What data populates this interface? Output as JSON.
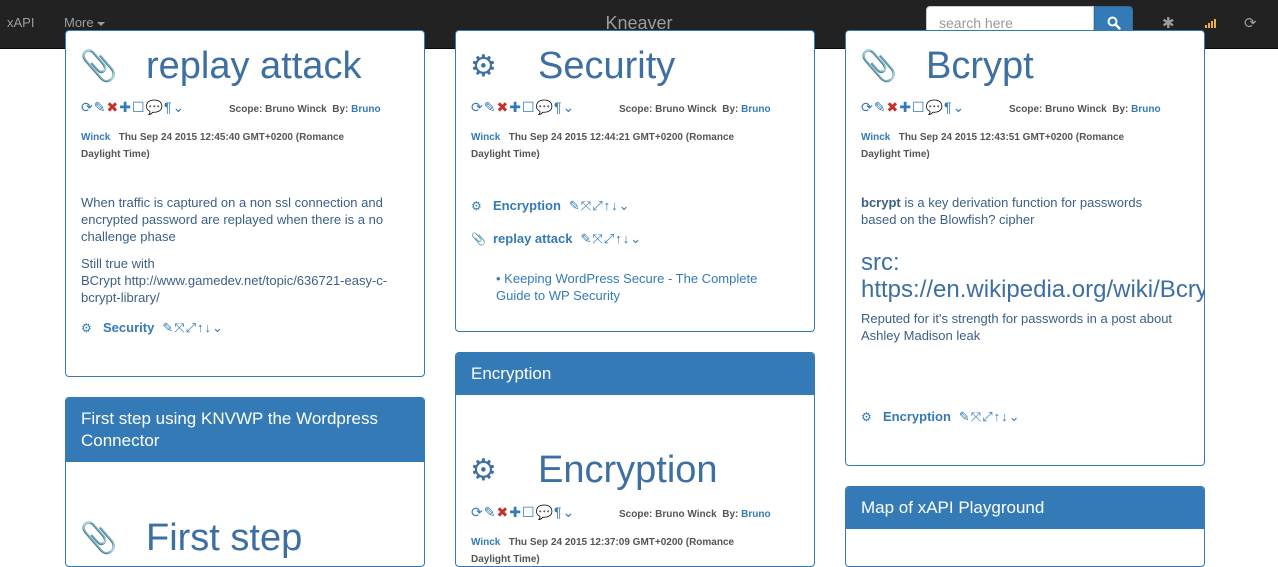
{
  "nav": {
    "left_link": "xAPI",
    "more_label": "More",
    "brand": "Kneaver",
    "search_placeholder": "search here",
    "icons": [
      "search-icon",
      "asterisk-icon",
      "signal-icon",
      "refresh-icon"
    ]
  },
  "colors": {
    "primary": "#337ab7",
    "navbar": "#222222",
    "danger": "#c9302c",
    "signal": "#f0ad4e"
  },
  "tool_glyphs": "⟳✎✖✚☐💬¶⌄",
  "link_actions": "✎⤧⤢↑↓⌄",
  "cards": {
    "replay": {
      "title": "replay attack",
      "scope_label": "Scope:",
      "scope": "Bruno Winck",
      "by_label": "By:",
      "by": "Bruno",
      "author": "Winck",
      "date_line1": "Thu Sep 24 2015 12:45:40 GMT+0200 (Romance",
      "date_line2": "Daylight Time)",
      "para1": "When traffic is captured on a non ssl connection and encrypted password are replayed when there is a no challenge phase",
      "para2_a": "Still true with",
      "para2_b": "BCrypt http://www.gamedev.net/topic/636721-easy-c-bcrypt-library/",
      "link1": "Security"
    },
    "security": {
      "title": "Security",
      "scope_label": "Scope:",
      "scope": "Bruno Winck",
      "by_label": "By:",
      "by": "Bruno",
      "author": "Winck",
      "date_line1": "Thu Sep 24 2015 12:44:21 GMT+0200 (Romance",
      "date_line2": "Daylight Time)",
      "link1": "Encryption",
      "link2": "replay attack",
      "bullet": "Keeping WordPress Secure - The Complete Guide to WP Security"
    },
    "bcrypt": {
      "title": "Bcrypt",
      "scope_label": "Scope:",
      "scope": "Bruno Winck",
      "by_label": "By:",
      "by": "Bruno",
      "author": "Winck",
      "date_line1": "Thu Sep 24 2015 12:43:51 GMT+0200 (Romance",
      "date_line2": "Daylight Time)",
      "bold_word": "bcrypt",
      "para1_rest": " is a key derivation function for passwords based on the Blowfish? cipher",
      "src_line1": "src:",
      "src_line2": "https://en.wikipedia.org/wiki/Bcrypt",
      "para2": "Reputed for it's strength for passwords in a post about Ashley Madison leak",
      "link1": "Encryption"
    },
    "first_step": {
      "heading": "First step using KNVWP the Wordpress Connector",
      "title": "First step"
    },
    "encryption": {
      "heading": "Encryption",
      "title": "Encryption",
      "scope_label": "Scope:",
      "scope": "Bruno Winck",
      "by_label": "By:",
      "by": "Bruno",
      "author": "Winck",
      "date_line1": "Thu Sep 24 2015 12:37:09 GMT+0200 (Romance",
      "date_line2": "Daylight Time)"
    },
    "map": {
      "heading": "Map of xAPI Playground"
    }
  }
}
